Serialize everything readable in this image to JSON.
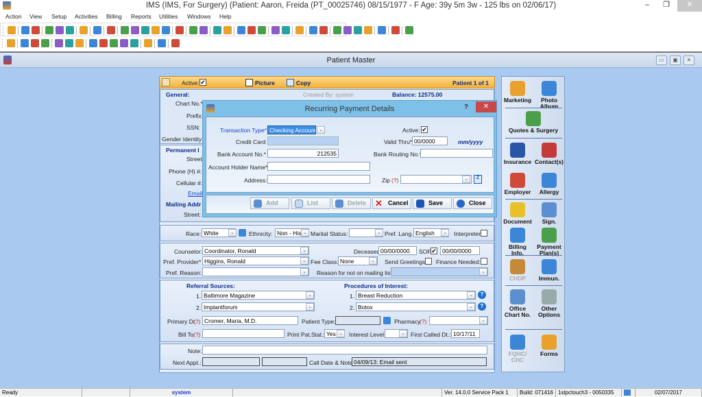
{
  "window": {
    "title": "IMS (IMS, For Surgery)    (Patient: Aaron, Freida  (PT_00025746) 08/15/1977 - F Age: 39y 5m 3w - 125 lbs on 02/06/17)",
    "minimize": "–",
    "restore": "❐",
    "close": "✕"
  },
  "menu": [
    "Action",
    "View",
    "Setup",
    "Activities",
    "Billing",
    "Reports",
    "Utilities",
    "Windows",
    "Help"
  ],
  "toolbar1_icons": [
    "patient-icon",
    "patient-add-icon",
    "patient-edit-icon",
    "folder-icon",
    "edit-note-icon",
    "lab-flask-icon",
    "prescription-icon",
    "document-icon",
    "notes-icon",
    "dollar-icon",
    "dollar-doc-icon",
    "billing-icon",
    "payment-icon",
    "payment-refresh-icon",
    "calendar-icon",
    "schedule-icon",
    "report-icon",
    "letter-icon",
    "camera-icon",
    "photos-icon",
    "calendar-new-icon",
    "checklist-icon",
    "chart-icon",
    "contacts-icon",
    "reports2-icon",
    "transfer-icon",
    "export-icon",
    "preview-icon",
    "photo-icon",
    "toggle-icon",
    "memo-icon",
    "help-icon",
    "lock-icon",
    "exit-icon"
  ],
  "toolbar2_icons": [
    "find-icon",
    "add-icon",
    "edit-icon",
    "delete-icon",
    "save-icon",
    "open-icon",
    "window-icon",
    "first-icon",
    "prev-icon",
    "next-icon",
    "last-icon",
    "sort-icon",
    "refresh-icon",
    "help-icon",
    "close-icon"
  ],
  "mdi": {
    "title": "Patient Master",
    "buttons": [
      "▭",
      "▣",
      "✕"
    ]
  },
  "patient": {
    "active_label": "Active:",
    "active_checked": true,
    "picture_label": "Picture",
    "copy_label": "Copy",
    "counter": "Patient 1 of 1",
    "general_label": "General:",
    "created_by": "Created By: system",
    "balance": "Balance: 12575.00",
    "chart_no_label": "Chart No.*",
    "prefix_label": "Prefix:",
    "ssn_label": "SSN:",
    "gender_label": "Gender Identity:",
    "permanent_label": "Permanent I",
    "street_label": "Street*",
    "phone_label": "Phone (H) #:",
    "cellular_label": "Cellular #:",
    "email_label": "Email:",
    "mailing_label": "Mailing Addr",
    "mailing_street_label": "Street:",
    "race_label": "Race:",
    "race": "White",
    "ethnicity_label": "Ethnicity:",
    "ethnicity": "Non - His",
    "marital_label": "Marital Status:",
    "marital": "",
    "lang_label": "Pref. Lang.*",
    "lang": "English",
    "interpreter_label": "Interpreter:",
    "counselor_label": "Counselor:",
    "counselor": "Coordinator, Ronald",
    "deceased_label": "Deceased:",
    "deceased": "00/00/0000",
    "sof_label": "SOF:",
    "sof_date": "00/00/0000",
    "provider_label": "Pref. Provider*",
    "provider": "Higgins, Ronald",
    "fee_class_label": "Fee Class:",
    "fee_class": "None",
    "greetings_label": "Send Greetings:",
    "finance_label": "Finance Needed:",
    "reason_label": "Pref. Reason:",
    "reason": "",
    "mailing_reason_label": "Reason for not on mailing list:",
    "referral_title": "Referral Sources:",
    "referrals": [
      {
        "n": "1.",
        "v": "Baltimore Magazine"
      },
      {
        "n": "2.",
        "v": "Implantforum"
      }
    ],
    "procedures_title": "Procedures of Interest:",
    "procedures": [
      {
        "n": "1.",
        "v": "Breast Reduction"
      },
      {
        "n": "2.",
        "v": "Botox"
      }
    ],
    "primary_dr_label": "Primary Dr.",
    "primary_dr": "Cromer, Maria, M.D.",
    "patient_type_label": "Patient Type:",
    "pharmacy_label": "Pharmacy",
    "bill_to_label": "Bill To",
    "print_stat_label": "Print Pat.Stat.:",
    "print_stat": "Yes",
    "interest_label": "Interest Level:",
    "first_called_label": "First Called Dt.:",
    "first_called": "10/17/11",
    "help_mark": "(?)",
    "note_label": "Note:",
    "next_appt_label": "Next Appt.:",
    "call_note_label": "Call Date & Note:",
    "call_note": "04/09/13: Email sent"
  },
  "side_panel": [
    {
      "label": "Marketing",
      "icon": "marketing-icon",
      "disabled": false
    },
    {
      "label": "Photo Album",
      "icon": "photo-album-icon",
      "disabled": false
    },
    {
      "label": "Quotes & Surgery",
      "icon": "quotes-icon",
      "disabled": false
    },
    {
      "label": "Insurance",
      "icon": "insurance-icon",
      "disabled": false
    },
    {
      "label": "Contact(s)",
      "icon": "contacts-icon",
      "disabled": false
    },
    {
      "label": "Employer",
      "icon": "employer-icon",
      "disabled": false
    },
    {
      "label": "Allergy",
      "icon": "allergy-icon",
      "disabled": false
    },
    {
      "label": "Document",
      "icon": "document-icon",
      "disabled": false
    },
    {
      "label": "Sign.",
      "icon": "signature-icon",
      "disabled": false
    },
    {
      "label": "Billing Info.",
      "icon": "billing-info-icon",
      "disabled": false
    },
    {
      "label": "Payment Plan(s)",
      "icon": "payment-plan-icon",
      "disabled": false
    },
    {
      "label": "CHDP",
      "icon": "chdp-icon",
      "disabled": true
    },
    {
      "label": "Immun.",
      "icon": "immunization-icon",
      "disabled": false
    },
    {
      "label": "Office Chart No.",
      "icon": "office-chart-icon",
      "disabled": false
    },
    {
      "label": "Other Options",
      "icon": "other-options-icon",
      "disabled": false
    },
    {
      "label": "FQHC/ CHC",
      "icon": "fqhc-icon",
      "disabled": true
    },
    {
      "label": "Forms",
      "icon": "forms-icon",
      "disabled": false
    }
  ],
  "dialog": {
    "title": "Recurring Payment Details",
    "help": "?",
    "close": "✕",
    "transaction_type_label": "Transaction Type*",
    "transaction_type": "Checking Account",
    "active_label": "Active:",
    "active_checked": true,
    "credit_card_label": "Credit Card No.*",
    "credit_card": "",
    "valid_thru_label": "Valid Thru*",
    "valid_thru": "00/0000",
    "valid_thru_format": "mm/yyyy",
    "bank_account_label": "Bank Account No.*",
    "bank_account": "212535",
    "routing_label": "Bank Routing No.*",
    "routing": "",
    "holder_label": "Account Holder Name*",
    "holder": "",
    "address_label": "Address:",
    "address": "",
    "zip_label": "Zip",
    "zip_help": "(?)",
    "zip": "",
    "buttons": {
      "add": "Add",
      "list": "List",
      "delete": "Delete",
      "cancel": "Cancel",
      "save": "Save",
      "close": "Close"
    }
  },
  "status": {
    "ready": "Ready",
    "user": "system",
    "version": "Ver. 14.0.0 Service Pack 1",
    "build": "Build: 071416",
    "server": "1stpctouch3 - 0050335",
    "date": "02/07/2017"
  }
}
